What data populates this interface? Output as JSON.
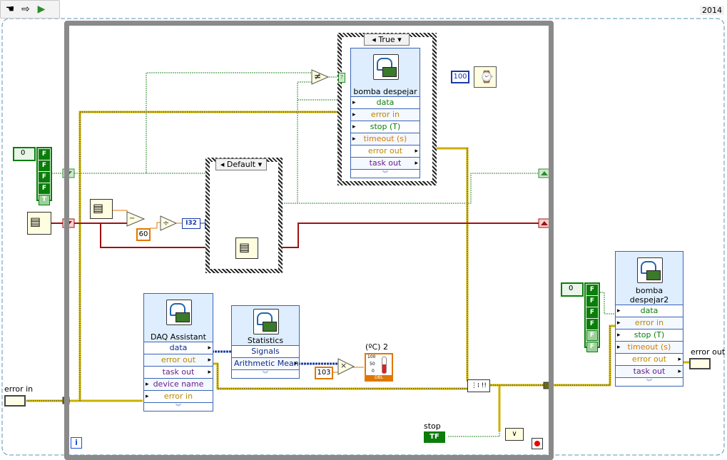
{
  "version": "2014",
  "toolbar": {
    "icons": [
      "hand-icon",
      "arrow-icon",
      "run-icon"
    ]
  },
  "loop": {
    "iteration_label": "i"
  },
  "case_top": {
    "selector": "True"
  },
  "case_mid": {
    "selector": "Default"
  },
  "express_top": {
    "title": "bomba despejar",
    "rows": [
      "data",
      "error in",
      "stop (T)",
      "timeout (s)",
      "error out",
      "task out"
    ]
  },
  "express_right": {
    "title_line1": "bomba",
    "title_line2": "despejar2",
    "rows": [
      "data",
      "error in",
      "stop (T)",
      "timeout (s)",
      "error out",
      "task out"
    ]
  },
  "daq_assistant": {
    "title": "DAQ Assistant",
    "rows": [
      "data",
      "error out",
      "task out",
      "device name",
      "error in"
    ]
  },
  "statistics": {
    "title": "Statistics",
    "rows": [
      "Signals",
      "Arithmetic Mean"
    ]
  },
  "constants": {
    "wait_ms": "100",
    "divisor": "60",
    "multiplier": "103",
    "array_index_left": "0",
    "array_index_right": "0",
    "conversion": "I32",
    "not_equal": "≠",
    "divide": "÷",
    "multiply": "×",
    "or": "∨"
  },
  "bool_array_left": [
    "F",
    "F",
    "F",
    "F",
    "T"
  ],
  "bool_array_right": [
    "F",
    "F",
    "F",
    "F",
    "F",
    "F"
  ],
  "indicators": {
    "thermometer_label": "(ºC) 2",
    "thermometer_ticks": [
      "100",
      "50",
      "0"
    ],
    "thermometer_unit": "DBL"
  },
  "labels": {
    "error_in": "error in",
    "error_out": "error out",
    "stop": "stop",
    "stop_const": "TF"
  },
  "colors": {
    "boolean_wire": "#2e8b2e",
    "error_wire": "#c9b100",
    "refnum_wire": "#a01010",
    "dynamic_wire": "#1a3aa8",
    "numeric_wire": "#e07800",
    "loop_border": "#8a8a8a"
  }
}
